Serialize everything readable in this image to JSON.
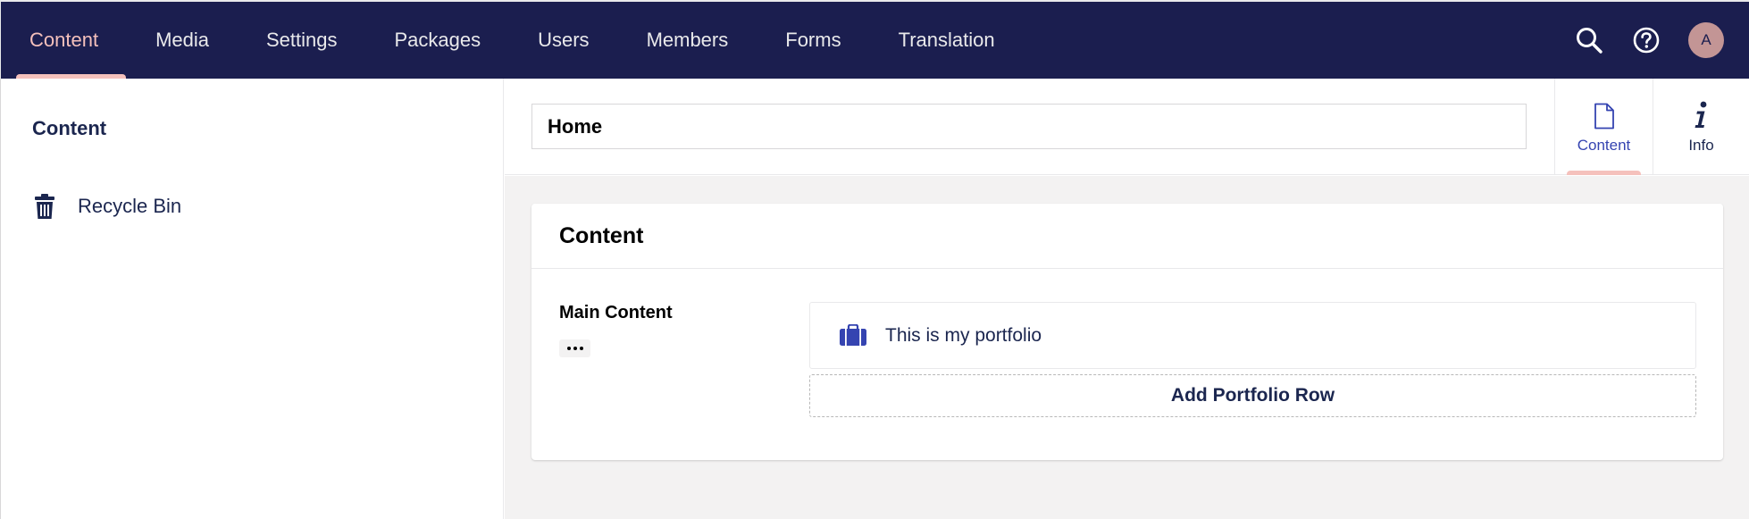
{
  "topnav": {
    "sections": [
      {
        "label": "Content",
        "active": true
      },
      {
        "label": "Media"
      },
      {
        "label": "Settings"
      },
      {
        "label": "Packages"
      },
      {
        "label": "Users"
      },
      {
        "label": "Members"
      },
      {
        "label": "Forms"
      },
      {
        "label": "Translation"
      }
    ],
    "tools": {
      "search_icon": "search-icon",
      "help_icon": "help-icon",
      "avatar_initial": "A"
    }
  },
  "tree": {
    "root_label": "Content",
    "items": [
      {
        "label": "Recycle Bin",
        "icon": "trash-icon"
      }
    ]
  },
  "editor": {
    "name_value": "Home",
    "apps": [
      {
        "label": "Content",
        "icon": "document-icon",
        "active": true
      },
      {
        "label": "Info",
        "icon": "info-icon"
      }
    ],
    "group_title": "Content",
    "property": {
      "label": "Main Content",
      "blocks": [
        {
          "label": "This is my portfolio",
          "icon": "briefcase-icon"
        }
      ],
      "add_button_label": "Add Portfolio Row"
    }
  },
  "colors": {
    "header_bg": "#1b1e4f",
    "active_accent": "#f5c1bc",
    "text_dark": "#1b264f",
    "block_icon": "#3544b1",
    "body_bg": "#f3f2f2"
  }
}
